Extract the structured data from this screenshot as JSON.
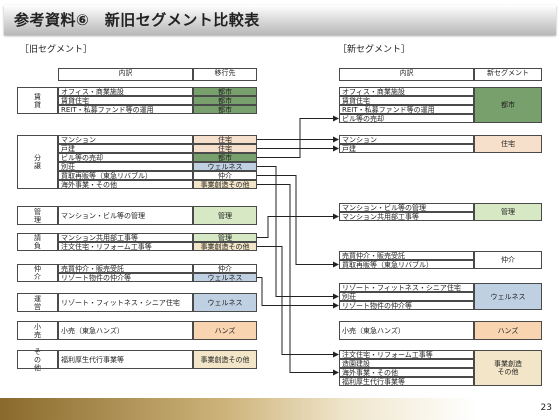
{
  "title": "参考資料⑥　新旧セグメント比較表",
  "old_label": "［旧セグメント］",
  "new_label": "［新セグメント］",
  "old": {
    "header_item": "内訳",
    "header_dest": "移行先",
    "groups": [
      {
        "cat": "賃\n貸",
        "items": [
          "オフィス・商業施設",
          "賃貸住宅",
          "REIT・私募ファンド等の運用"
        ],
        "dests": [
          "都市",
          "都市",
          "都市"
        ]
      },
      {
        "cat": "分\n譲",
        "items": [
          "マンション",
          "戸建",
          "ビル等の売却",
          "別荘",
          "買取再販等（東急リバブル）",
          "海外事業・その他"
        ],
        "dests": [
          "住宅",
          "住宅",
          "都市",
          "ウェルネス",
          "仲介",
          "事業創造その他"
        ]
      },
      {
        "cat": "管\n理",
        "items": [
          "マンション・ビル等の管理"
        ],
        "dests": [
          "管理"
        ]
      },
      {
        "cat": "請\n負",
        "items": [
          "マンション共用部工事等",
          "注文住宅・リフォーム工事等"
        ],
        "dests": [
          "管理",
          "事業創造その他"
        ]
      },
      {
        "cat": "仲\n介",
        "items": [
          "売買仲介・販売受託",
          "リゾート物件の仲介等"
        ],
        "dests": [
          "仲介",
          "ウェルネス"
        ]
      },
      {
        "cat": "運\n営",
        "items": [
          "リゾート・フィットネス・シニア住宅"
        ],
        "dests": [
          "ウェルネス"
        ]
      },
      {
        "cat": "小\n売",
        "items": [
          "小売（東急ハンズ）"
        ],
        "dests": [
          "ハンズ"
        ]
      },
      {
        "cat": "そ\nの\n他",
        "items": [
          "福利厚生代行事業等"
        ],
        "dests": [
          "事業創造その他"
        ]
      }
    ]
  },
  "new": {
    "header_item": "内訳",
    "header_seg": "新セグメント",
    "groups": [
      {
        "items": [
          "オフィス・商業施設",
          "賃貸住宅",
          "REIT・私募ファンド等の運用",
          "ビル等の売却"
        ],
        "seg": "都市"
      },
      {
        "items": [
          "マンション",
          "戸建"
        ],
        "seg": "住宅"
      },
      {
        "items": [
          "マンション・ビル等の管理",
          "マンション共用部工事等"
        ],
        "seg": "管理"
      },
      {
        "items": [
          "売買仲介・販売受託",
          "買取再販等（東急リバブル）"
        ],
        "seg": "仲介"
      },
      {
        "items": [
          "リゾート・フィットネス・シニア住宅",
          "別荘",
          "リゾート物件の仲介等"
        ],
        "seg": "ウェルネス"
      },
      {
        "items": [
          "小売（東急ハンズ）"
        ],
        "seg": "ハンズ"
      },
      {
        "items": [
          "注文住宅・リフォーム工事等",
          "造園建設",
          "海外事業・その他",
          "福利厚生代行事業等"
        ],
        "seg": "事業創造\nその他"
      }
    ]
  },
  "page_number": "23",
  "colors": {
    "都市": "#77a06c",
    "住宅": "#f6e0cc",
    "ウェルネス": "#bfd0e2",
    "仲介": "#ffffff",
    "管理": "#d7e8c4",
    "事業創造その他": "#f3e6c8",
    "ハンズ": "#f8d4b0"
  }
}
